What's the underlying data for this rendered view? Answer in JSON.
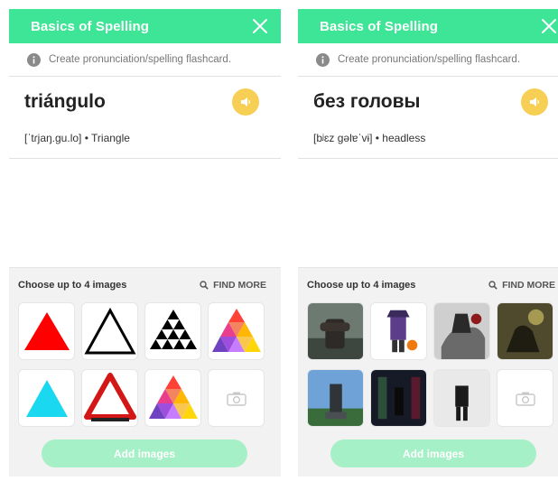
{
  "panels": [
    {
      "header_title": "Basics of Spelling",
      "info_text": "Create pronunciation/spelling flashcard.",
      "word": "triángulo",
      "pronunciation": "[ˈtɾjaŋ.gu.lo] • Triangle",
      "images_label": "Choose up to 4 images",
      "find_more": "FIND MORE",
      "add_button": "Add images"
    },
    {
      "header_title": "Basics of Spelling",
      "info_text": "Create pronunciation/spelling flashcard.",
      "word": "без головы",
      "pronunciation": "[bʲɛz gəlɐˈvɨ] • headless",
      "images_label": "Choose up to 4 images",
      "find_more": "FIND MORE",
      "add_button": "Add images"
    }
  ],
  "colors": {
    "header": "#3ee596",
    "speaker": "#f7cf55",
    "add_button": "#a6f0c8"
  }
}
